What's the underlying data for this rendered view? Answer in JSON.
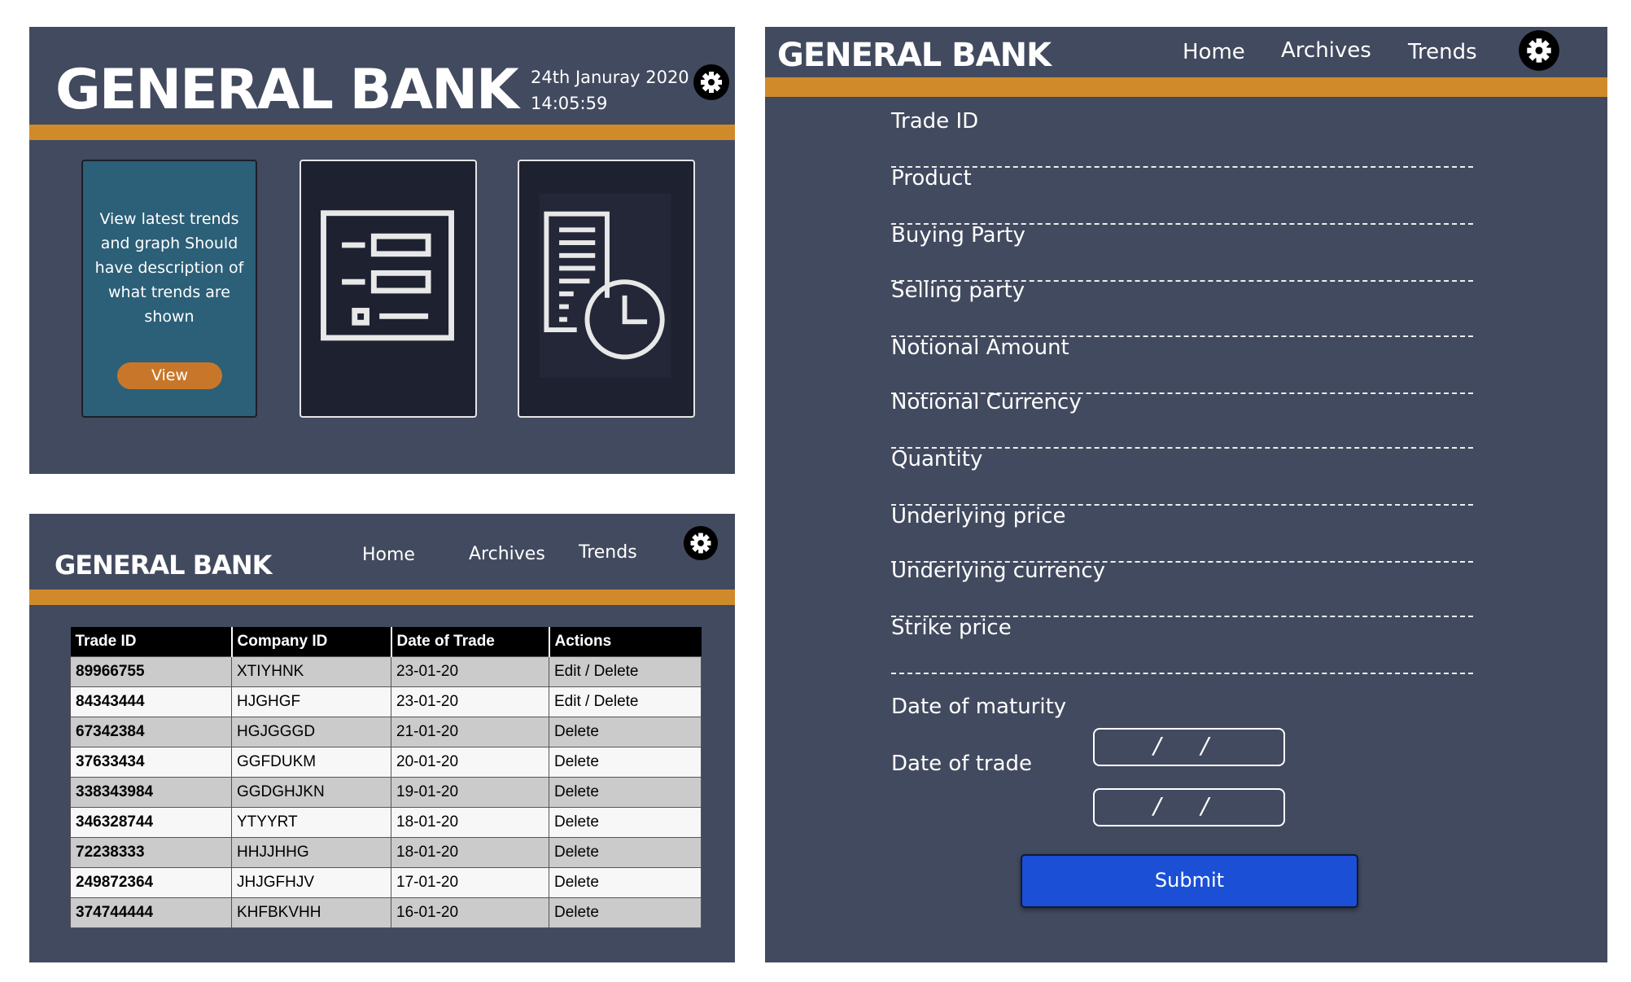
{
  "dashboard": {
    "brand": "GENERAL BANK",
    "date": "24th Januray 2020",
    "time": "14:05:59",
    "settings_icon": "gear-icon",
    "cards": {
      "trends": {
        "description": "View latest trends and graph Should have description of what trends are shown",
        "button_label": "View"
      },
      "form": {
        "icon": "form-list-icon"
      },
      "history": {
        "icon": "document-clock-icon"
      }
    }
  },
  "archives": {
    "brand": "GENERAL BANK",
    "nav": {
      "home": "Home",
      "archives": "Archives",
      "trends": "Trends"
    },
    "settings_icon": "gear-icon",
    "table": {
      "headers": [
        "Trade ID",
        "Company ID",
        "Date of Trade",
        "Actions"
      ],
      "rows": [
        [
          "89966755",
          "XTIYHNK",
          "23-01-20",
          "Edit / Delete"
        ],
        [
          "84343444",
          "HJGHGF",
          "23-01-20",
          "Edit / Delete"
        ],
        [
          "67342384",
          "HGJGGGD",
          "21-01-20",
          "Delete"
        ],
        [
          "37633434",
          "GGFDUKM",
          "20-01-20",
          "Delete"
        ],
        [
          "338343984",
          "GGDGHJKN",
          "19-01-20",
          "Delete"
        ],
        [
          "346328744",
          "YTYYRT",
          "18-01-20",
          "Delete"
        ],
        [
          "72238333",
          "HHJJHHG",
          "18-01-20",
          "Delete"
        ],
        [
          "249872364",
          "JHJGFHJV",
          "17-01-20",
          "Delete"
        ],
        [
          "374744444",
          "KHFBKVHH",
          "16-01-20",
          "Delete"
        ]
      ]
    }
  },
  "trade_form": {
    "brand": "GENERAL BANK",
    "nav": {
      "home": "Home",
      "archives": "Archives",
      "trends": "Trends"
    },
    "settings_icon": "gear-icon",
    "fields": [
      "Trade ID",
      "Product",
      "Buying Party",
      "Selling party",
      "Notional Amount",
      "Notional Currency",
      "Quantity",
      "Underlying price",
      "Underlying currency",
      "Strike price"
    ],
    "date_of_maturity_label": "Date of maturity",
    "date_of_trade_label": "Date of trade",
    "date_placeholder": "/ /",
    "submit_label": "Submit"
  },
  "colors": {
    "panel_bg": "#424a5f",
    "accent_orange": "#d18a2a",
    "trends_card": "#2c5f78",
    "view_button": "#c8772a",
    "submit_button": "#1b4fd6"
  }
}
